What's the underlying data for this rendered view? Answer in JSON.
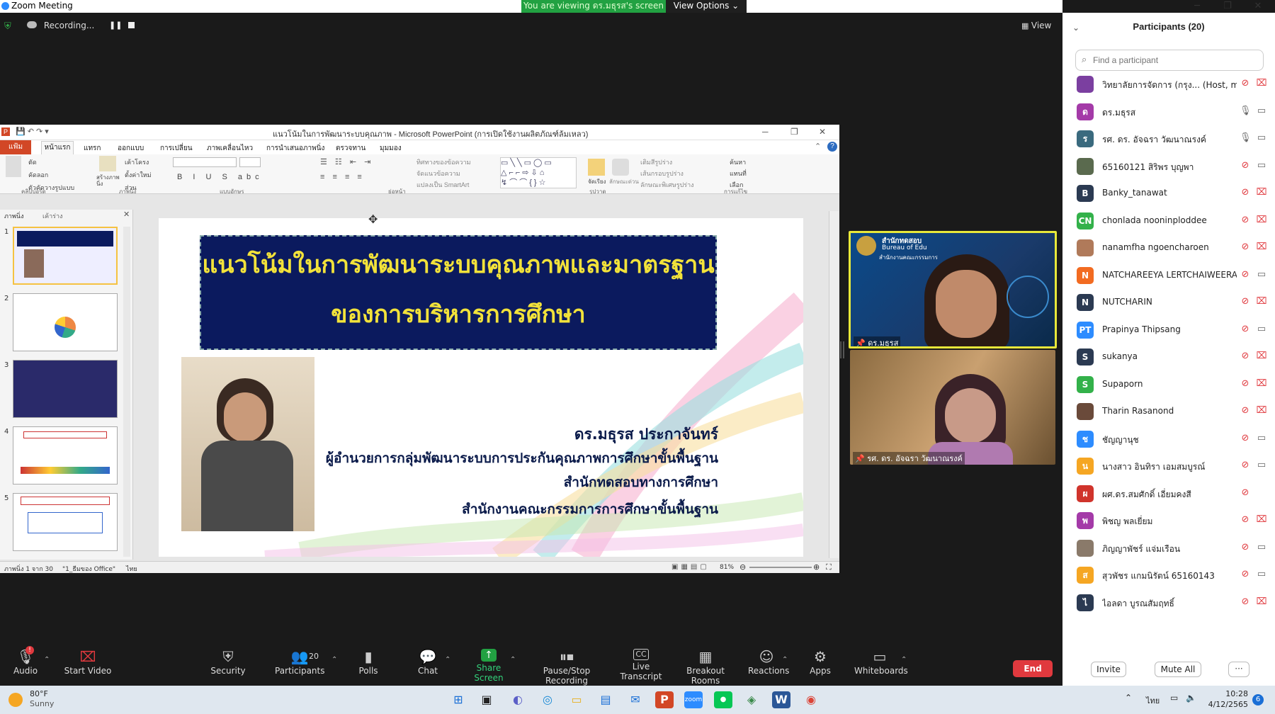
{
  "window": {
    "title": "Zoom Meeting"
  },
  "banner": {
    "viewing_text": "You are viewing ดร.มธุรส's screen",
    "view_options": "View Options ⌄"
  },
  "recording": {
    "label": "Recording..."
  },
  "view_button": "View",
  "ppt": {
    "title": "แนวโน้มในการพัฒนาระบบคุณภาพ - Microsoft PowerPoint (การเปิดใช้งานผลิตภัณฑ์ล้มเหลว)",
    "file_tab": "แฟ้ม",
    "tabs": [
      "หน้าแรก",
      "แทรก",
      "ออกแบบ",
      "การเปลี่ยน",
      "ภาพเคลื่อนไหว",
      "การนำเสนอภาพนิ่ง",
      "ตรวจทาน",
      "มุมมอง"
    ],
    "ribbon_groups": [
      "คลิปบอร์ด",
      "ภาพนิ่ง",
      "แบบอักษร",
      "ย่อหน้า",
      "รูปวาด",
      "การแก้ไข"
    ],
    "ribbon_items": [
      "ตัด",
      "คัดลอก",
      "ตัวคัดวางรูปแบบ",
      "เค้าโครง",
      "ตั้งค่าใหม่",
      "ส่วน",
      "ทิศทางของข้อความ",
      "จัดแนวข้อความ",
      "แปลงเป็น SmartArt",
      "เติมสีรูปร่าง",
      "เส้นกรอบรูปร่าง",
      "ลักษณะพิเศษรูปร่าง",
      "ค้นหา",
      "แทนที่",
      "เลือก",
      "สร้างภาพนิ่ง",
      "จัดเรียง",
      "ลักษณะด่วน"
    ],
    "pane_tabs": [
      "ภาพนิ่ง",
      "เค้าร่าง"
    ],
    "slide_numbers": [
      "1",
      "2",
      "3",
      "4",
      "5"
    ],
    "status_left": "ภาพนิ่ง 1 จาก 30",
    "status_theme": "\"1_ธีมของ Office\"",
    "status_lang": "ไทย",
    "zoom": "81%"
  },
  "slide": {
    "title_line1": "แนวโน้มในการพัฒนาระบบคุณภาพและมาตรฐาน",
    "title_line2": "ของการบริหารการศึกษา",
    "presenter_name": "ดร.มธุรส  ประกาจันทร์",
    "presenter_role1": "ผู้อำนวยการกลุ่มพัฒนาระบบการประกันคุณภาพการศึกษาขั้นพื้นฐาน",
    "presenter_role2": "สำนักทดสอบทางการศึกษา",
    "presenter_role3": "สำนักงานคณะกรรมการการศึกษาขั้นพื้นฐาน"
  },
  "videos": [
    {
      "name": "ดร.มธุรส",
      "bg_text": "สำนักทดสอบ",
      "bg_text2": "Bureau of Edu",
      "bg_text3": "สำนักงานคณะกรรมการ"
    },
    {
      "name": "รศ. ดร. อัจฉรา วัฒนาณรงค์"
    }
  ],
  "panel": {
    "title": "Participants (20)",
    "search_placeholder": "Find a participant",
    "invite": "Invite",
    "mute_all": "Mute All",
    "more": "···"
  },
  "participants": [
    {
      "name": "วิทยาลัยการจัดการ (กรุง... (Host, me)",
      "initial": "",
      "color": "#7b3fa0",
      "mic": "muted",
      "cam": "off"
    },
    {
      "name": "ดร.มธุรส",
      "initial": "ด",
      "color": "#a43aa8",
      "mic": "on",
      "cam": "on"
    },
    {
      "name": "รศ. ดร. อัจฉรา วัฒนาณรงค์",
      "initial": "ร",
      "color": "#3a6a7e",
      "mic": "on",
      "cam": "on"
    },
    {
      "name": "65160121 สิริพร บุญพา",
      "initial": "",
      "color": "#5a6a4e",
      "mic": "muted",
      "cam": "on"
    },
    {
      "name": "Banky_tanawat",
      "initial": "B",
      "color": "#2b3a52",
      "mic": "muted",
      "cam": "off"
    },
    {
      "name": "chonlada nooninploddee",
      "initial": "CN",
      "color": "#33b14a",
      "mic": "muted",
      "cam": "off"
    },
    {
      "name": "nanamfha ngoencharoen",
      "initial": "",
      "color": "#b07a5a",
      "mic": "muted",
      "cam": "off"
    },
    {
      "name": "NATCHAREEYA LERTCHAIWEERA...",
      "initial": "N",
      "color": "#f26b21",
      "mic": "muted",
      "cam": "on"
    },
    {
      "name": "NUTCHARIN",
      "initial": "N",
      "color": "#2b3a52",
      "mic": "muted",
      "cam": "off"
    },
    {
      "name": "Prapinya  Thipsang",
      "initial": "PT",
      "color": "#2d8cff",
      "mic": "muted",
      "cam": "on"
    },
    {
      "name": "sukanya",
      "initial": "S",
      "color": "#2b3a52",
      "mic": "muted",
      "cam": "off"
    },
    {
      "name": "Supaporn",
      "initial": "S",
      "color": "#33b14a",
      "mic": "muted",
      "cam": "off"
    },
    {
      "name": "Tharin Rasanond",
      "initial": "",
      "color": "#6a4a3a",
      "mic": "muted",
      "cam": "off"
    },
    {
      "name": "ชัญญานุช",
      "initial": "ช",
      "color": "#2d8cff",
      "mic": "muted",
      "cam": "on"
    },
    {
      "name": "นางสาว อินทิรา เอมสมบูรณ์",
      "initial": "น",
      "color": "#f5a623",
      "mic": "muted",
      "cam": "on"
    },
    {
      "name": "ผศ.ดร.สมศักดิ์ เอี่ยมคงสี",
      "initial": "ผ",
      "color": "#d0342c",
      "mic": "muted",
      "cam": "none"
    },
    {
      "name": "พิชญ พลเยี่ยม",
      "initial": "พ",
      "color": "#a43aa8",
      "mic": "muted",
      "cam": "off"
    },
    {
      "name": "ภิญญาพัชร์ แจ่มเรือน",
      "initial": "",
      "color": "#8a7a6a",
      "mic": "muted",
      "cam": "on"
    },
    {
      "name": "สุวพัชร แกมนิรัตน์ 65160143",
      "initial": "ส",
      "color": "#f5a623",
      "mic": "muted",
      "cam": "on"
    },
    {
      "name": "ไอลดา บูรณสัมฤทธิ์",
      "initial": "ไ",
      "color": "#2b3a52",
      "mic": "muted",
      "cam": "off"
    }
  ],
  "toolbar": {
    "audio": "Audio",
    "start_video": "Start Video",
    "security": "Security",
    "participants": "Participants",
    "participants_count": "20",
    "polls": "Polls",
    "chat": "Chat",
    "share_screen": "Share Screen",
    "pause_stop_recording": "Pause/Stop Recording",
    "live_transcript": "Live Transcript",
    "breakout_rooms": "Breakout Rooms",
    "reactions": "Reactions",
    "apps": "Apps",
    "whiteboards": "Whiteboards",
    "end": "End",
    "audio_badge": "!",
    "transcript_icon": "CC"
  },
  "taskbar": {
    "weather_temp": "80°F",
    "weather_desc": "Sunny",
    "lang": "ไทย",
    "time": "10:28",
    "date": "4/12/2565",
    "notif": "6",
    "app_word": "W",
    "app_ppt": "P",
    "app_zoom": "zoom"
  }
}
